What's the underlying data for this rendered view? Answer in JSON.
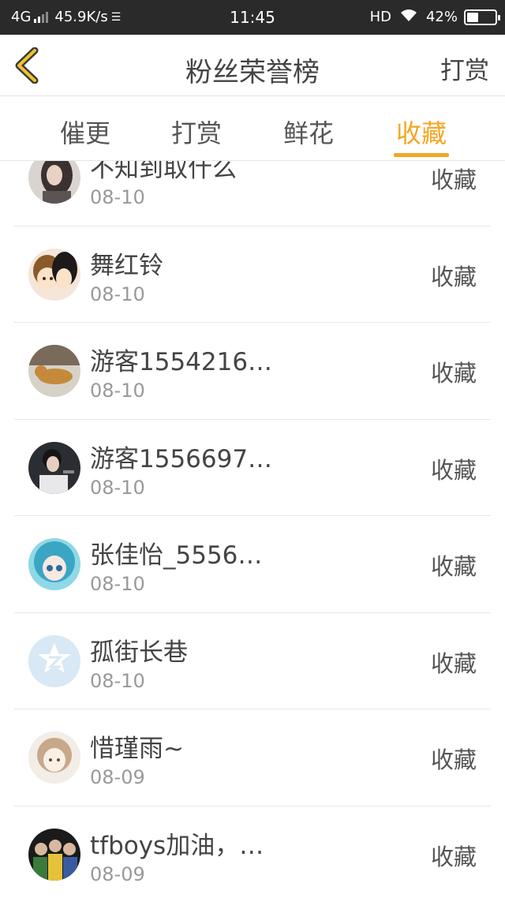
{
  "status_bar": {
    "network": "4G",
    "speed": "45.9K/s",
    "time": "11:45",
    "hd": "HD",
    "battery_percent": "42%",
    "battery_level": 0.42
  },
  "header": {
    "back_icon": "chevron-left-icon",
    "title": "粉丝荣誉榜",
    "action_label": "打赏",
    "accent_color": "#f5a623"
  },
  "tabs": [
    {
      "label": "催更",
      "active": false
    },
    {
      "label": "打赏",
      "active": false
    },
    {
      "label": "鲜花",
      "active": false
    },
    {
      "label": "收藏",
      "active": true
    }
  ],
  "fans": [
    {
      "name": "不知到取什么",
      "date": "08-10",
      "action": "收藏",
      "avatar": "girl-photo"
    },
    {
      "name": "舞红铃",
      "date": "08-10",
      "action": "收藏",
      "avatar": "anime-pair"
    },
    {
      "name": "游客1554216…",
      "date": "08-10",
      "action": "收藏",
      "avatar": "dog-photo"
    },
    {
      "name": "游客1556697…",
      "date": "08-10",
      "action": "收藏",
      "avatar": "singer-photo"
    },
    {
      "name": "张佳怡_5556…",
      "date": "08-10",
      "action": "收藏",
      "avatar": "anime-girl-blue"
    },
    {
      "name": "孤街长巷",
      "date": "08-10",
      "action": "收藏",
      "avatar": "default-qq"
    },
    {
      "name": "惜瑾雨~",
      "date": "08-09",
      "action": "收藏",
      "avatar": "anime-sketch"
    },
    {
      "name": "tfboys加油，…",
      "date": "08-09",
      "action": "收藏",
      "avatar": "group-photo"
    }
  ]
}
